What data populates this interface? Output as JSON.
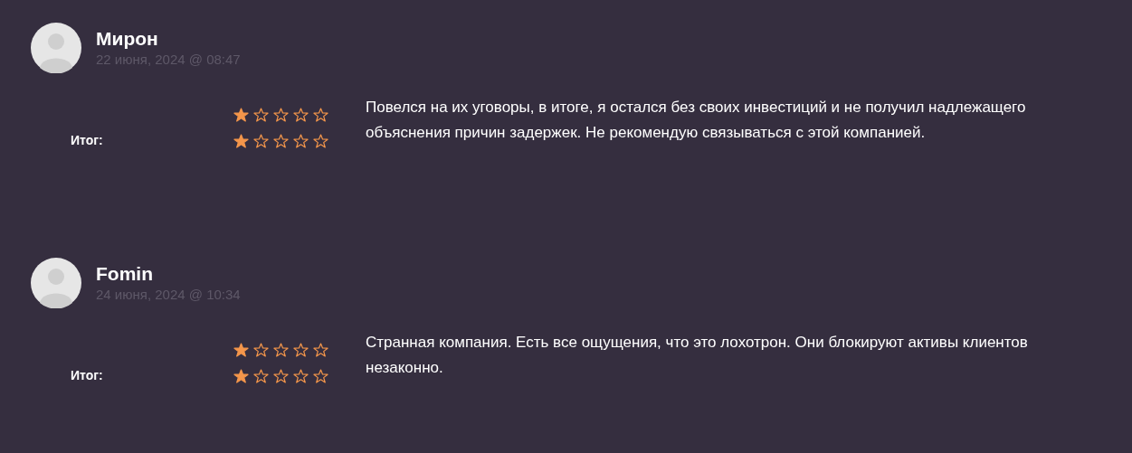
{
  "reviews": [
    {
      "author": "Мирон",
      "date": "22 июня, 2024 @ 08:47",
      "ratings": [
        {
          "stars": 1
        },
        {
          "label": "Итог:",
          "stars": 1
        }
      ],
      "text": "Повелся на их уговоры, в итоге, я остался без своих инвестиций и не получил надлежащего объяснения причин задержек. Не рекомендую связываться с этой компанией."
    },
    {
      "author": "Fomin",
      "date": "24 июня, 2024 @ 10:34",
      "ratings": [
        {
          "stars": 1
        },
        {
          "label": "Итог:",
          "stars": 1
        }
      ],
      "text": "Странная компания. Есть все ощущения, что это лохотрон. Они блокируют активы клиентов незаконно."
    }
  ]
}
